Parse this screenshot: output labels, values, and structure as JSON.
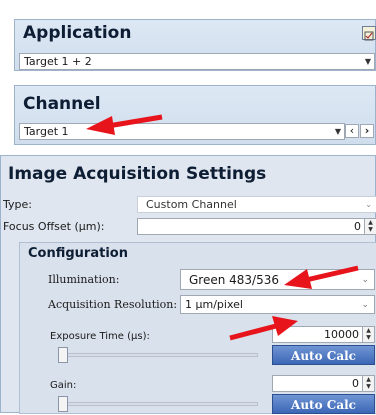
{
  "application": {
    "title": "Application",
    "selected": "Target 1 + 2"
  },
  "channel": {
    "title": "Channel",
    "selected": "Target 1",
    "prev_icon": "‹",
    "next_icon": "›"
  },
  "acquisition": {
    "title": "Image Acquisition Settings",
    "type_label": "Type:",
    "type_value": "Custom Channel",
    "focus_label": "Focus Offset (µm):",
    "focus_value": "0"
  },
  "configuration": {
    "title": "Configuration",
    "illumination_label": "Illumination:",
    "illumination_value": "Green 483/536",
    "resolution_label": "Acquisition Resolution:",
    "resolution_value": "1 µm/pixel",
    "exposure_label": "Exposure Time (µs):",
    "exposure_value": "10000",
    "gain_label": "Gain:",
    "gain_value": "0",
    "auto_calc": "Auto Calc"
  },
  "colors": {
    "annotation_arrow": "#e8141c",
    "auto_calc_button": "#4a74c0"
  }
}
